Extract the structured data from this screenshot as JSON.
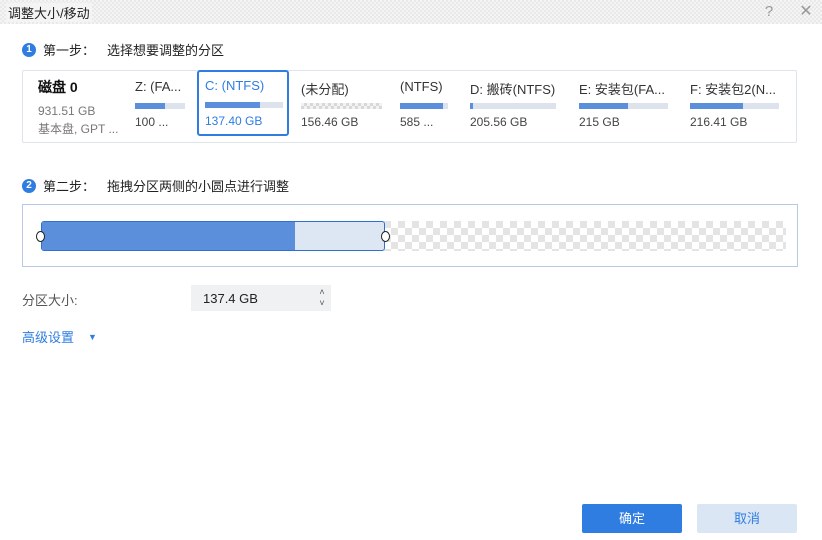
{
  "window": {
    "title": "调整大小/移动",
    "help_glyph": "?",
    "close_glyph": "✕"
  },
  "step1": {
    "num": "1",
    "prefix": "第一步：",
    "text": "选择想要调整的分区"
  },
  "step2": {
    "num": "2",
    "prefix": "第二步：",
    "text": "拖拽分区两侧的小圆点进行调整"
  },
  "disk": {
    "name": "磁盘 0",
    "size": "931.51 GB",
    "type": "基本盘, GPT ..."
  },
  "partitions": [
    {
      "label": "Z: (FA...",
      "size": "100 ...",
      "used_fraction": 0.6,
      "unallocated": false,
      "selected": false
    },
    {
      "label": "C: (NTFS)",
      "size": "137.40 GB",
      "used_fraction": 0.7,
      "unallocated": false,
      "selected": true
    },
    {
      "label": "(未分配)",
      "size": "156.46 GB",
      "used_fraction": 0,
      "unallocated": true,
      "selected": false
    },
    {
      "label": "(NTFS)",
      "size": "585 ...",
      "used_fraction": 0.9,
      "unallocated": false,
      "selected": false
    },
    {
      "label": "D: 搬砖(NTFS)",
      "size": "205.56 GB",
      "used_fraction": 0.03,
      "unallocated": false,
      "selected": false
    },
    {
      "label": "E: 安装包(FA...",
      "size": "215 GB",
      "used_fraction": 0.55,
      "unallocated": false,
      "selected": false
    },
    {
      "label": "F: 安装包2(N...",
      "size": "216.41 GB",
      "used_fraction": 0.6,
      "unallocated": false,
      "selected": false
    }
  ],
  "resize": {
    "used_fraction": 0.74
  },
  "size_field": {
    "label": "分区大小:",
    "value": "137.4 GB",
    "up": "˄",
    "down": "˅"
  },
  "advanced": {
    "label": "高级设置",
    "arrow": "▼"
  },
  "buttons": {
    "ok": "确定",
    "cancel": "取消"
  },
  "colors": {
    "accent": "#2f7de1",
    "bar_fill": "#5b8fdc"
  }
}
